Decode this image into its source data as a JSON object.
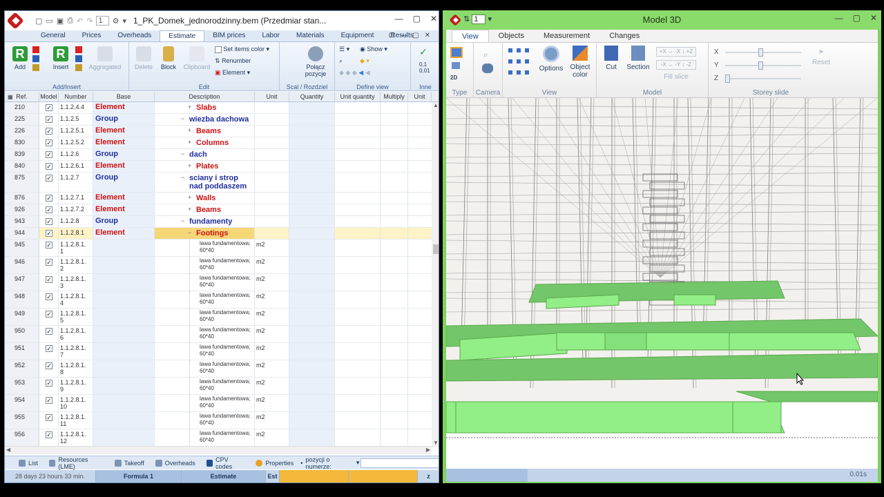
{
  "left_window": {
    "title": "1_PK_Domek_jednorodzinny.bem (Przedmiar stan...",
    "qat_counter": "1",
    "ribbon_tabs": [
      "General",
      "Prices",
      "Overheads",
      "Estimate",
      "BIM prices",
      "Labor",
      "Materials",
      "Equipment",
      "Results"
    ],
    "active_tab": "Estimate",
    "groups": {
      "add_insert": "Add/Insert",
      "edit": "Edit",
      "scal": "Scal / Rozdziel",
      "define_view": "Define view",
      "inne": "Inne"
    },
    "buttons": {
      "add": "Add",
      "insert": "Insert",
      "aggregated": "Aggregated",
      "delete": "Delete",
      "block": "Block",
      "clipboard": "Clipboard",
      "set_items_color": "Set items color",
      "renumber": "Renumber",
      "element": "Element",
      "polacz": "Połącz",
      "pozycje": "pozycje",
      "show": "Show",
      "inne_value": "0,1\n0,01"
    },
    "columns": [
      "Ref.",
      "Model",
      "Number",
      "Base",
      "Description",
      "Unit",
      "Quantity",
      "Unit quantity",
      "Multiply",
      "Unit"
    ],
    "rows": [
      {
        "ref": "210",
        "number": "1.1.2.4.4",
        "base": "Element",
        "type": "el",
        "desc": "Slabs",
        "tog": "+",
        "lvl": 1
      },
      {
        "ref": "225",
        "number": "1.1.2.5",
        "base": "Group",
        "type": "gr",
        "desc": "wiezba dachowa",
        "tog": "−",
        "lvl": 0
      },
      {
        "ref": "226",
        "number": "1.1.2.5.1",
        "base": "Element",
        "type": "el",
        "desc": "Beams",
        "tog": "+",
        "lvl": 1
      },
      {
        "ref": "830",
        "number": "1.1.2.5.2",
        "base": "Element",
        "type": "el",
        "desc": "Columns",
        "tog": "+",
        "lvl": 1
      },
      {
        "ref": "839",
        "number": "1.1.2.6",
        "base": "Group",
        "type": "gr",
        "desc": "dach",
        "tog": "−",
        "lvl": 0
      },
      {
        "ref": "840",
        "number": "1.1.2.6.1",
        "base": "Element",
        "type": "el",
        "desc": "Plates",
        "tog": "+",
        "lvl": 1
      },
      {
        "ref": "875",
        "number": "1.1.2.7",
        "base": "Group",
        "type": "gr",
        "desc": "sciany i strop nad poddaszem",
        "tog": "−",
        "lvl": 0
      },
      {
        "ref": "876",
        "number": "1.1.2.7.1",
        "base": "Element",
        "type": "el",
        "desc": "Walls",
        "tog": "+",
        "lvl": 1
      },
      {
        "ref": "926",
        "number": "1.1.2.7.2",
        "base": "Element",
        "type": "el",
        "desc": "Beams",
        "tog": "+",
        "lvl": 1
      },
      {
        "ref": "943",
        "number": "1.1.2.8",
        "base": "Group",
        "type": "gr",
        "desc": "fundamenty",
        "tog": "−",
        "lvl": 0
      },
      {
        "ref": "944",
        "number": "1.1.2.8.1",
        "base": "Element",
        "type": "el",
        "desc": "Footings",
        "tog": "−",
        "lvl": 1
      },
      {
        "ref": "945",
        "number": "1.1.2.8.1.\n1",
        "desc1": "lawa fundamentowa;",
        "desc2": "60*40",
        "unit": "m2"
      },
      {
        "ref": "946",
        "number": "1.1.2.8.1.\n2",
        "desc1": "lawa fundamentowa;",
        "desc2": "60*40",
        "unit": "m2"
      },
      {
        "ref": "947",
        "number": "1.1.2.8.1.\n3",
        "desc1": "lawa fundamentowa;",
        "desc2": "60*40",
        "unit": "m2"
      },
      {
        "ref": "948",
        "number": "1.1.2.8.1.\n4",
        "desc1": "lawa fundamentowa;",
        "desc2": "60*40",
        "unit": "m2"
      },
      {
        "ref": "949",
        "number": "1.1.2.8.1.\n5",
        "desc1": "lawa fundamentowa;",
        "desc2": "60*40",
        "unit": "m2"
      },
      {
        "ref": "950",
        "number": "1.1.2.8.1.\n6",
        "desc1": "lawa fundamentowa;",
        "desc2": "60*40",
        "unit": "m2"
      },
      {
        "ref": "951",
        "number": "1.1.2.8.1.\n7",
        "desc1": "lawa fundamentowa;",
        "desc2": "60*40",
        "unit": "m2"
      },
      {
        "ref": "952",
        "number": "1.1.2.8.1.\n8",
        "desc1": "lawa fundamentowa;",
        "desc2": "60*40",
        "unit": "m2"
      },
      {
        "ref": "953",
        "number": "1.1.2.8.1.\n9",
        "desc1": "lawa fundamentowa;",
        "desc2": "60*40",
        "unit": "m2"
      },
      {
        "ref": "954",
        "number": "1.1.2.8.1.\n10",
        "desc1": "lawa fundamentowa;",
        "desc2": "60*40",
        "unit": "m2"
      },
      {
        "ref": "955",
        "number": "1.1.2.8.1.\n11",
        "desc1": "lawa fundamentowa;",
        "desc2": "60*40",
        "unit": "m2"
      },
      {
        "ref": "956",
        "number": "1.1.2.8.1.\n12",
        "desc1": "lawa fundamentowa;",
        "desc2": "60*40",
        "unit": "m2"
      }
    ],
    "bottom_tabs": [
      "List",
      "Resources (LME)",
      "Takeoff",
      "Overheads",
      "CPV codes",
      "Properties"
    ],
    "properties_dropdown": "pozycji o numerze:",
    "status": {
      "time": "28 days 23 hours 33 min.",
      "formula": "Formula 1",
      "estimate": "Estimate",
      "est": "Est",
      "z": "z"
    }
  },
  "right_window": {
    "title": "Model 3D",
    "qat_counter": "1",
    "tabs": [
      "View",
      "Objects",
      "Measurement",
      "Changes"
    ],
    "active_tab": "View",
    "groups": {
      "type": "Type",
      "camera": "Camera",
      "view": "View",
      "model": "Model",
      "storey_slide": "Storey slide"
    },
    "buttons": {
      "two_d": "2D",
      "options": "Options",
      "object_color": "Object color",
      "cut": "Cut",
      "section": "Section",
      "fill_slice": "Fill slice",
      "reset": "Reset",
      "axis_x": "X",
      "axis_y": "Y",
      "axis_z": "Z"
    },
    "slider_labels": [
      "+X ↔ -X ↕ +Z",
      "-X ↔ -Y ↕ -Z"
    ],
    "status_time": "0.01s"
  },
  "colors": {
    "accent_blue": "#dfe9f5",
    "element_red": "#cc1111",
    "group_blue": "#1e2ea0",
    "model_green": "#8adb6c",
    "footing_green": "#92ee86",
    "selected_row": "#fdf3c6"
  }
}
